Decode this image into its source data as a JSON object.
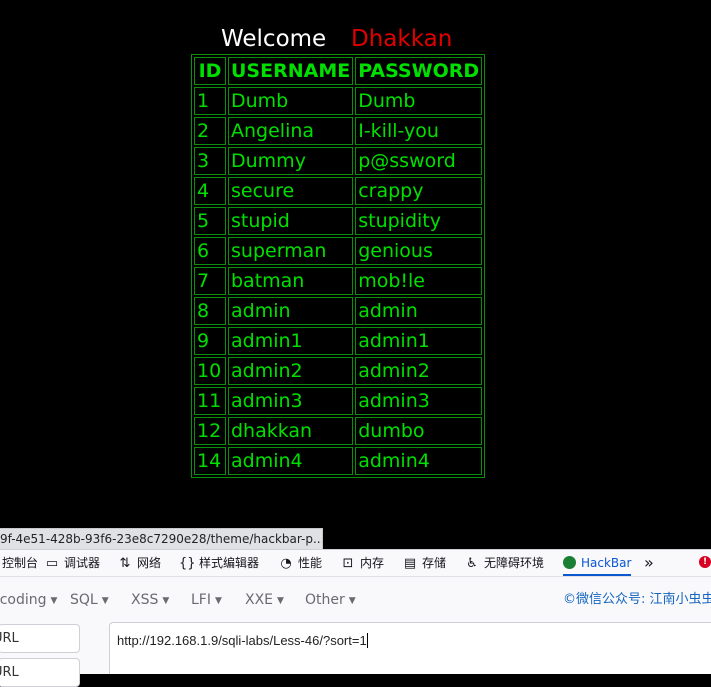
{
  "page": {
    "welcome": "Welcome",
    "name": "Dhakkan"
  },
  "table": {
    "headers": [
      "ID",
      "USERNAME",
      "PASSWORD"
    ],
    "rows": [
      [
        "1",
        "Dumb",
        "Dumb"
      ],
      [
        "2",
        "Angelina",
        "I-kill-you"
      ],
      [
        "3",
        "Dummy",
        "p@ssword"
      ],
      [
        "4",
        "secure",
        "crappy"
      ],
      [
        "5",
        "stupid",
        "stupidity"
      ],
      [
        "6",
        "superman",
        "genious"
      ],
      [
        "7",
        "batman",
        "mob!le"
      ],
      [
        "8",
        "admin",
        "admin"
      ],
      [
        "9",
        "admin1",
        "admin1"
      ],
      [
        "10",
        "admin2",
        "admin2"
      ],
      [
        "11",
        "admin3",
        "admin3"
      ],
      [
        "12",
        "dhakkan",
        "dumbo"
      ],
      [
        "14",
        "admin4",
        "admin4"
      ]
    ]
  },
  "statusbar": {
    "text": "9f-4e51-428b-93f6-23e8c7290e28/theme/hackbar-p..."
  },
  "devtools": {
    "tabs": [
      {
        "label": "控制台",
        "icon": "console-icon"
      },
      {
        "label": "调试器",
        "icon": "debugger-icon"
      },
      {
        "label": "网络",
        "icon": "network-icon"
      },
      {
        "label": "样式编辑器",
        "icon": "style-editor-icon"
      },
      {
        "label": "性能",
        "icon": "performance-icon"
      },
      {
        "label": "内存",
        "icon": "memory-icon"
      },
      {
        "label": "存储",
        "icon": "storage-icon"
      },
      {
        "label": "无障碍环境",
        "icon": "accessibility-icon"
      },
      {
        "label": "HackBar",
        "icon": "hackbar-icon"
      }
    ],
    "overflow": "»",
    "error_badge": "!",
    "accent_color": "#0b57d0"
  },
  "hackbar": {
    "menus": [
      "Encoding",
      "SQL",
      "XSS",
      "LFI",
      "XXE",
      "Other"
    ],
    "promo": "©微信公众号: 江南小虫虫",
    "side_buttons": [
      "URL",
      "URL"
    ],
    "url_value": "http://192.168.1.9/sqli-labs/Less-46/?sort=1"
  }
}
